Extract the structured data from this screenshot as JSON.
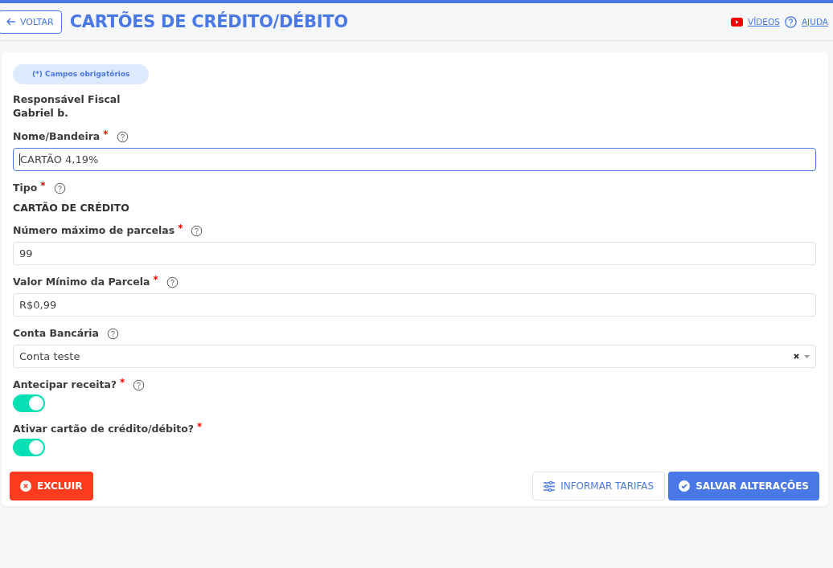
{
  "header": {
    "back_button": "VOLTAR",
    "title": "CARTÕES DE CRÉDITO/DÉBITO",
    "videos_link": "VÍDEOS",
    "help_link": "AJUDA"
  },
  "required_note": "(*) Campos obrigatórios",
  "fields": [
    {
      "kind": "info",
      "label": "Responsável Fiscal",
      "value": "Gabriel b."
    },
    {
      "kind": "input",
      "label": "Nome/Bandeira",
      "required_mark": "*",
      "help": true,
      "value": "CARTÃO 4,19%",
      "focused": true
    },
    {
      "kind": "text",
      "label": "Tipo",
      "required_mark": "*",
      "help": true,
      "value": "CARTÃO DE CRÉDITO"
    },
    {
      "kind": "input",
      "label": "Número máximo de parcelas",
      "required_mark": "*",
      "help": true,
      "value": "99",
      "focused": false
    },
    {
      "kind": "input",
      "label": "Valor Mínimo da Parcela",
      "required_mark": "*",
      "help": true,
      "value": "R$0,99",
      "focused": false
    },
    {
      "kind": "select",
      "label": "Conta Bancária",
      "help": true,
      "value": "Conta teste"
    },
    {
      "kind": "toggle",
      "label": "Antecipar receita?",
      "required_mark": "*",
      "help": true,
      "on": true
    },
    {
      "kind": "toggle",
      "label": "Ativar cartão de crédito/débito?",
      "required_mark": "*",
      "help": false,
      "on": true
    }
  ],
  "buttons": {
    "delete": "EXCLUIR",
    "fees": "INFORMAR TARIFAS",
    "save": "SALVAR ALTERAÇÕES"
  }
}
